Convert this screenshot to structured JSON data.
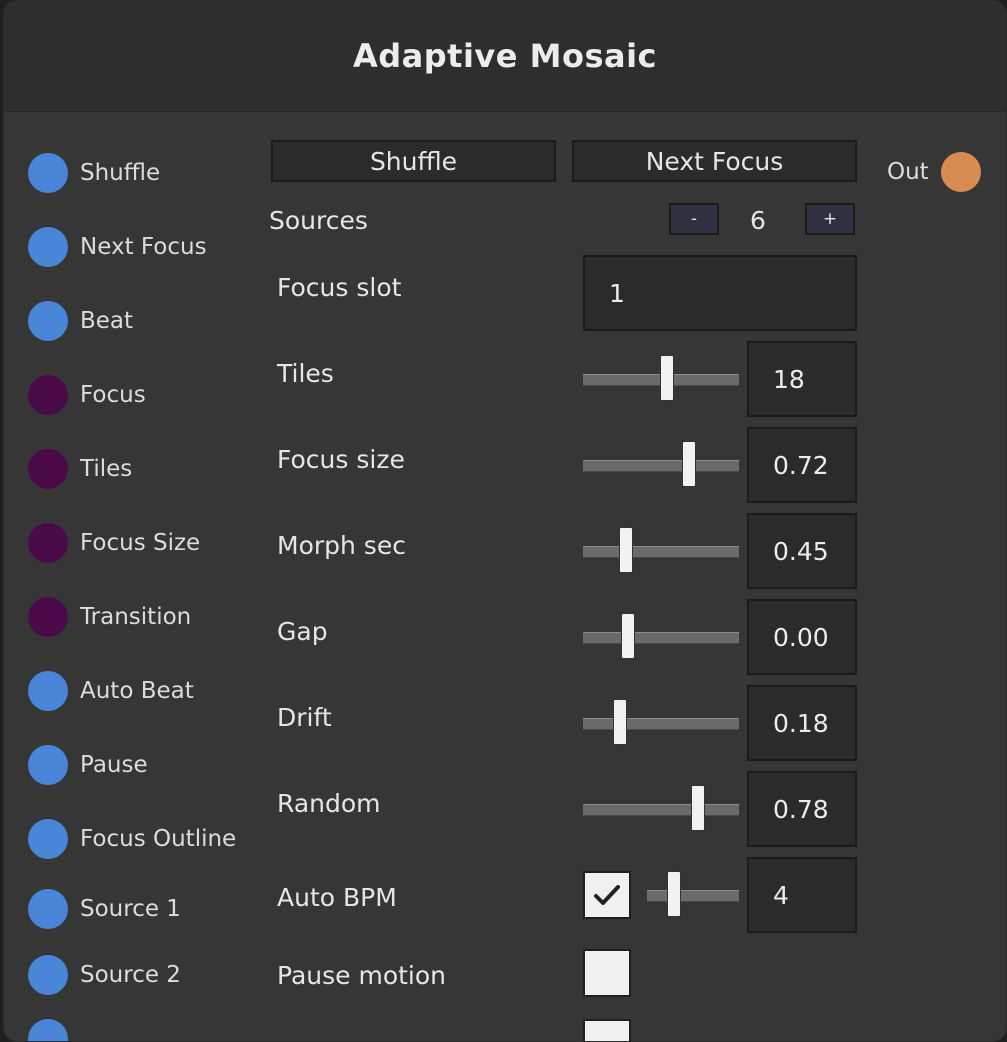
{
  "title": "Adaptive Mosaic",
  "colors": {
    "trigger_port": "#4a86d8",
    "value_port": "#4a0a4a",
    "output_port": "#d98c52"
  },
  "inputs": [
    {
      "label": "Shuffle",
      "kind": "trigger"
    },
    {
      "label": "Next Focus",
      "kind": "trigger"
    },
    {
      "label": "Beat",
      "kind": "trigger"
    },
    {
      "label": "Focus",
      "kind": "value"
    },
    {
      "label": "Tiles",
      "kind": "value"
    },
    {
      "label": "Focus Size",
      "kind": "value"
    },
    {
      "label": "Transition",
      "kind": "value"
    },
    {
      "label": "Auto Beat",
      "kind": "trigger"
    },
    {
      "label": "Pause",
      "kind": "trigger"
    },
    {
      "label": "Focus Outline",
      "kind": "trigger"
    },
    {
      "label": "Source 1",
      "kind": "trigger"
    },
    {
      "label": "Source 2",
      "kind": "trigger"
    }
  ],
  "output": {
    "label": "Out"
  },
  "buttons": {
    "shuffle": "Shuffle",
    "next_focus": "Next Focus"
  },
  "sources": {
    "label": "Sources",
    "count": "6",
    "minus": "-",
    "plus": "+"
  },
  "focus_slot": {
    "label": "Focus slot",
    "value": "1"
  },
  "params": [
    {
      "key": "tiles",
      "label": "Tiles",
      "value": "18",
      "fraction": 0.54
    },
    {
      "key": "focus_size",
      "label": "Focus size",
      "value": "0.72",
      "fraction": 0.7
    },
    {
      "key": "morph_sec",
      "label": "Morph sec",
      "value": "0.45",
      "fraction": 0.25
    },
    {
      "key": "gap",
      "label": "Gap",
      "value": "0.00",
      "fraction": 0.27
    },
    {
      "key": "drift",
      "label": "Drift",
      "value": "0.18",
      "fraction": 0.21
    },
    {
      "key": "random",
      "label": "Random",
      "value": "0.78",
      "fraction": 0.76
    }
  ],
  "auto_bpm": {
    "label": "Auto BPM",
    "checked": true,
    "value": "4",
    "fraction": 0.25
  },
  "pause_motion": {
    "label": "Pause motion",
    "checked": false
  }
}
